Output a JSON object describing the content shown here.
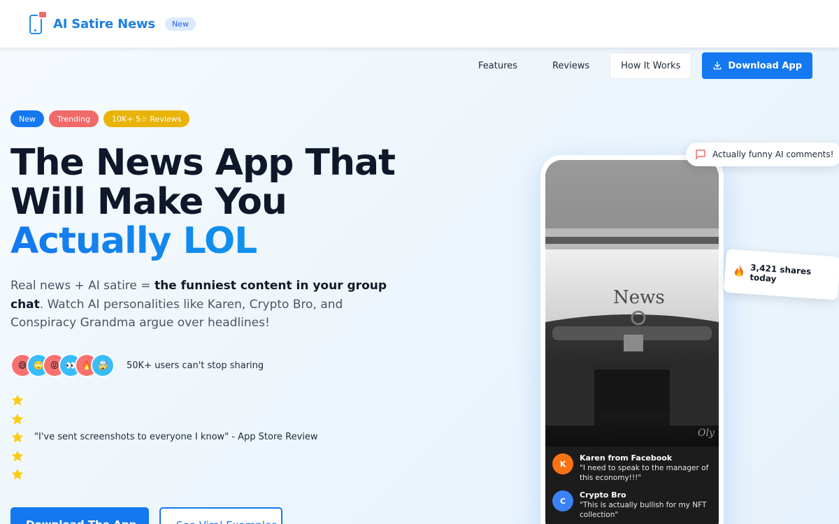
{
  "brand": {
    "name": "AI Satire News",
    "badge": "New"
  },
  "nav": {
    "features": "Features",
    "reviews": "Reviews",
    "how_it_works": "How It Works",
    "download": "Download App"
  },
  "badges": {
    "new": "New",
    "trending": "Trending",
    "reviews": "10K+ 5☆ Reviews"
  },
  "headline": {
    "line1": "The News App That",
    "line2": "Will Make You",
    "accent": "Actually LOL"
  },
  "subtext": {
    "part1": "Real news + AI satire = ",
    "bold": "the funniest content in your group chat",
    "part2": ". Watch AI personalities like Karen, Crypto Bro, and Conspiracy Grandma argue over headlines!"
  },
  "avatars": {
    "emojis": [
      "😅",
      "🙄",
      "😝",
      "👀",
      "🔥",
      "🤯"
    ],
    "text": "50K+ users can't stop sharing"
  },
  "review": {
    "stars": 5,
    "quote": "\"I've sent screenshots to everyone I know\" - App Store Review"
  },
  "cta": {
    "primary": "Download The App ☆",
    "secondary": "See Viral Examples"
  },
  "phone": {
    "photo_text": "News",
    "comments": [
      {
        "initial": "K",
        "name": "Karen from Facebook",
        "text": "\"I need to speak to the manager of this economy!!!\"",
        "color": "#f97316"
      },
      {
        "initial": "C",
        "name": "Crypto Bro",
        "text": "\"This is actually bullish for my NFT collection\"",
        "color": "#3b82f6"
      }
    ]
  },
  "floating": {
    "comments": "Actually funny AI comments!",
    "shares": "3,421 shares today"
  },
  "colors": {
    "primary": "#1478f0",
    "trending": "#f06a6a",
    "reviews_badge": "#eab308",
    "star": "#facc15"
  }
}
